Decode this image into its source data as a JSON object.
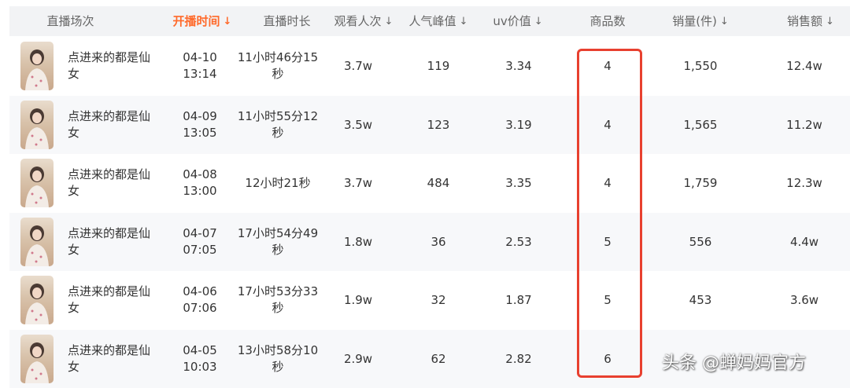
{
  "columns": [
    "直播场次",
    "开播时间",
    "直播时长",
    "观看人次",
    "人气峰值",
    "uv价值",
    "商品数",
    "销量(件)",
    "销售额"
  ],
  "sort_icon": "↓",
  "rows": [
    {
      "name": "点进来的都是仙女",
      "date": "04-10",
      "time": "13:14",
      "duration": "11小时46分15秒",
      "views": "3.7w",
      "peak": "119",
      "uv": "3.34",
      "items": "4",
      "sales_qty": "1,550",
      "revenue": "12.4w"
    },
    {
      "name": "点进来的都是仙女",
      "date": "04-09",
      "time": "13:05",
      "duration": "11小时55分12秒",
      "views": "3.5w",
      "peak": "123",
      "uv": "3.19",
      "items": "4",
      "sales_qty": "1,565",
      "revenue": "11.2w"
    },
    {
      "name": "点进来的都是仙女",
      "date": "04-08",
      "time": "13:00",
      "duration": "12小时21秒",
      "views": "3.7w",
      "peak": "484",
      "uv": "3.35",
      "items": "4",
      "sales_qty": "1,759",
      "revenue": "12.3w"
    },
    {
      "name": "点进来的都是仙女",
      "date": "04-07",
      "time": "07:05",
      "duration": "17小时54分49秒",
      "views": "1.8w",
      "peak": "36",
      "uv": "2.53",
      "items": "5",
      "sales_qty": "556",
      "revenue": "4.4w"
    },
    {
      "name": "点进来的都是仙女",
      "date": "04-06",
      "time": "07:06",
      "duration": "17小时53分33秒",
      "views": "1.9w",
      "peak": "32",
      "uv": "1.87",
      "items": "5",
      "sales_qty": "453",
      "revenue": "3.6w"
    },
    {
      "name": "点进来的都是仙女",
      "date": "04-05",
      "time": "10:03",
      "duration": "13小时58分10秒",
      "views": "2.9w",
      "peak": "62",
      "uv": "2.82",
      "items": "6",
      "sales_qty": "",
      "revenue": ""
    }
  ],
  "watermark": "头条 @蝉妈妈官方",
  "colors": {
    "active_header": "#ff6a2b",
    "highlight_border": "#e8402f",
    "header_bg": "#f2f3f5",
    "alt_row_bg": "#f7f8fa"
  }
}
